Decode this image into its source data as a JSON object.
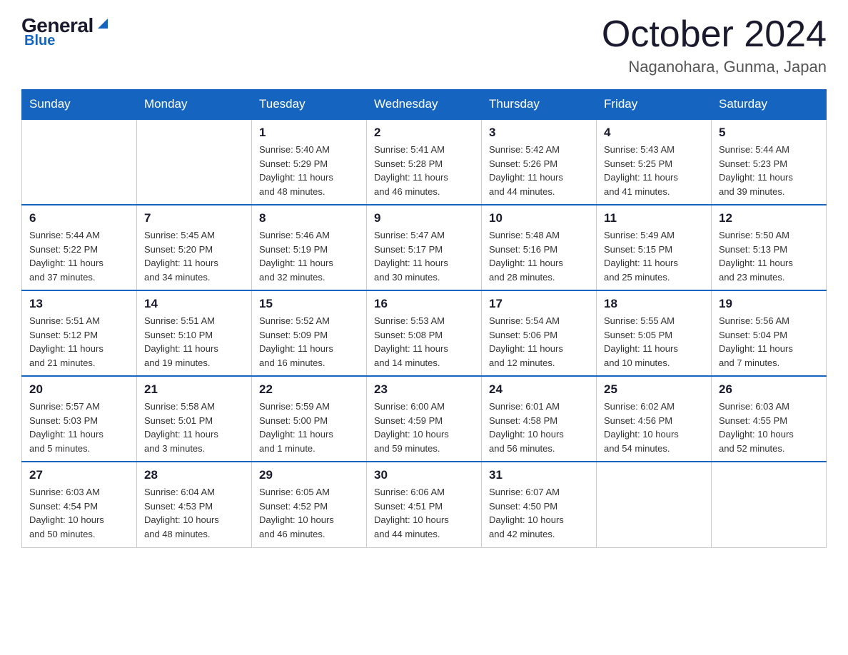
{
  "logo": {
    "general": "General",
    "blue": "Blue"
  },
  "title": "October 2024",
  "location": "Naganohara, Gunma, Japan",
  "days_of_week": [
    "Sunday",
    "Monday",
    "Tuesday",
    "Wednesday",
    "Thursday",
    "Friday",
    "Saturday"
  ],
  "weeks": [
    [
      {
        "day": "",
        "info": ""
      },
      {
        "day": "",
        "info": ""
      },
      {
        "day": "1",
        "info": "Sunrise: 5:40 AM\nSunset: 5:29 PM\nDaylight: 11 hours\nand 48 minutes."
      },
      {
        "day": "2",
        "info": "Sunrise: 5:41 AM\nSunset: 5:28 PM\nDaylight: 11 hours\nand 46 minutes."
      },
      {
        "day": "3",
        "info": "Sunrise: 5:42 AM\nSunset: 5:26 PM\nDaylight: 11 hours\nand 44 minutes."
      },
      {
        "day": "4",
        "info": "Sunrise: 5:43 AM\nSunset: 5:25 PM\nDaylight: 11 hours\nand 41 minutes."
      },
      {
        "day": "5",
        "info": "Sunrise: 5:44 AM\nSunset: 5:23 PM\nDaylight: 11 hours\nand 39 minutes."
      }
    ],
    [
      {
        "day": "6",
        "info": "Sunrise: 5:44 AM\nSunset: 5:22 PM\nDaylight: 11 hours\nand 37 minutes."
      },
      {
        "day": "7",
        "info": "Sunrise: 5:45 AM\nSunset: 5:20 PM\nDaylight: 11 hours\nand 34 minutes."
      },
      {
        "day": "8",
        "info": "Sunrise: 5:46 AM\nSunset: 5:19 PM\nDaylight: 11 hours\nand 32 minutes."
      },
      {
        "day": "9",
        "info": "Sunrise: 5:47 AM\nSunset: 5:17 PM\nDaylight: 11 hours\nand 30 minutes."
      },
      {
        "day": "10",
        "info": "Sunrise: 5:48 AM\nSunset: 5:16 PM\nDaylight: 11 hours\nand 28 minutes."
      },
      {
        "day": "11",
        "info": "Sunrise: 5:49 AM\nSunset: 5:15 PM\nDaylight: 11 hours\nand 25 minutes."
      },
      {
        "day": "12",
        "info": "Sunrise: 5:50 AM\nSunset: 5:13 PM\nDaylight: 11 hours\nand 23 minutes."
      }
    ],
    [
      {
        "day": "13",
        "info": "Sunrise: 5:51 AM\nSunset: 5:12 PM\nDaylight: 11 hours\nand 21 minutes."
      },
      {
        "day": "14",
        "info": "Sunrise: 5:51 AM\nSunset: 5:10 PM\nDaylight: 11 hours\nand 19 minutes."
      },
      {
        "day": "15",
        "info": "Sunrise: 5:52 AM\nSunset: 5:09 PM\nDaylight: 11 hours\nand 16 minutes."
      },
      {
        "day": "16",
        "info": "Sunrise: 5:53 AM\nSunset: 5:08 PM\nDaylight: 11 hours\nand 14 minutes."
      },
      {
        "day": "17",
        "info": "Sunrise: 5:54 AM\nSunset: 5:06 PM\nDaylight: 11 hours\nand 12 minutes."
      },
      {
        "day": "18",
        "info": "Sunrise: 5:55 AM\nSunset: 5:05 PM\nDaylight: 11 hours\nand 10 minutes."
      },
      {
        "day": "19",
        "info": "Sunrise: 5:56 AM\nSunset: 5:04 PM\nDaylight: 11 hours\nand 7 minutes."
      }
    ],
    [
      {
        "day": "20",
        "info": "Sunrise: 5:57 AM\nSunset: 5:03 PM\nDaylight: 11 hours\nand 5 minutes."
      },
      {
        "day": "21",
        "info": "Sunrise: 5:58 AM\nSunset: 5:01 PM\nDaylight: 11 hours\nand 3 minutes."
      },
      {
        "day": "22",
        "info": "Sunrise: 5:59 AM\nSunset: 5:00 PM\nDaylight: 11 hours\nand 1 minute."
      },
      {
        "day": "23",
        "info": "Sunrise: 6:00 AM\nSunset: 4:59 PM\nDaylight: 10 hours\nand 59 minutes."
      },
      {
        "day": "24",
        "info": "Sunrise: 6:01 AM\nSunset: 4:58 PM\nDaylight: 10 hours\nand 56 minutes."
      },
      {
        "day": "25",
        "info": "Sunrise: 6:02 AM\nSunset: 4:56 PM\nDaylight: 10 hours\nand 54 minutes."
      },
      {
        "day": "26",
        "info": "Sunrise: 6:03 AM\nSunset: 4:55 PM\nDaylight: 10 hours\nand 52 minutes."
      }
    ],
    [
      {
        "day": "27",
        "info": "Sunrise: 6:03 AM\nSunset: 4:54 PM\nDaylight: 10 hours\nand 50 minutes."
      },
      {
        "day": "28",
        "info": "Sunrise: 6:04 AM\nSunset: 4:53 PM\nDaylight: 10 hours\nand 48 minutes."
      },
      {
        "day": "29",
        "info": "Sunrise: 6:05 AM\nSunset: 4:52 PM\nDaylight: 10 hours\nand 46 minutes."
      },
      {
        "day": "30",
        "info": "Sunrise: 6:06 AM\nSunset: 4:51 PM\nDaylight: 10 hours\nand 44 minutes."
      },
      {
        "day": "31",
        "info": "Sunrise: 6:07 AM\nSunset: 4:50 PM\nDaylight: 10 hours\nand 42 minutes."
      },
      {
        "day": "",
        "info": ""
      },
      {
        "day": "",
        "info": ""
      }
    ]
  ]
}
